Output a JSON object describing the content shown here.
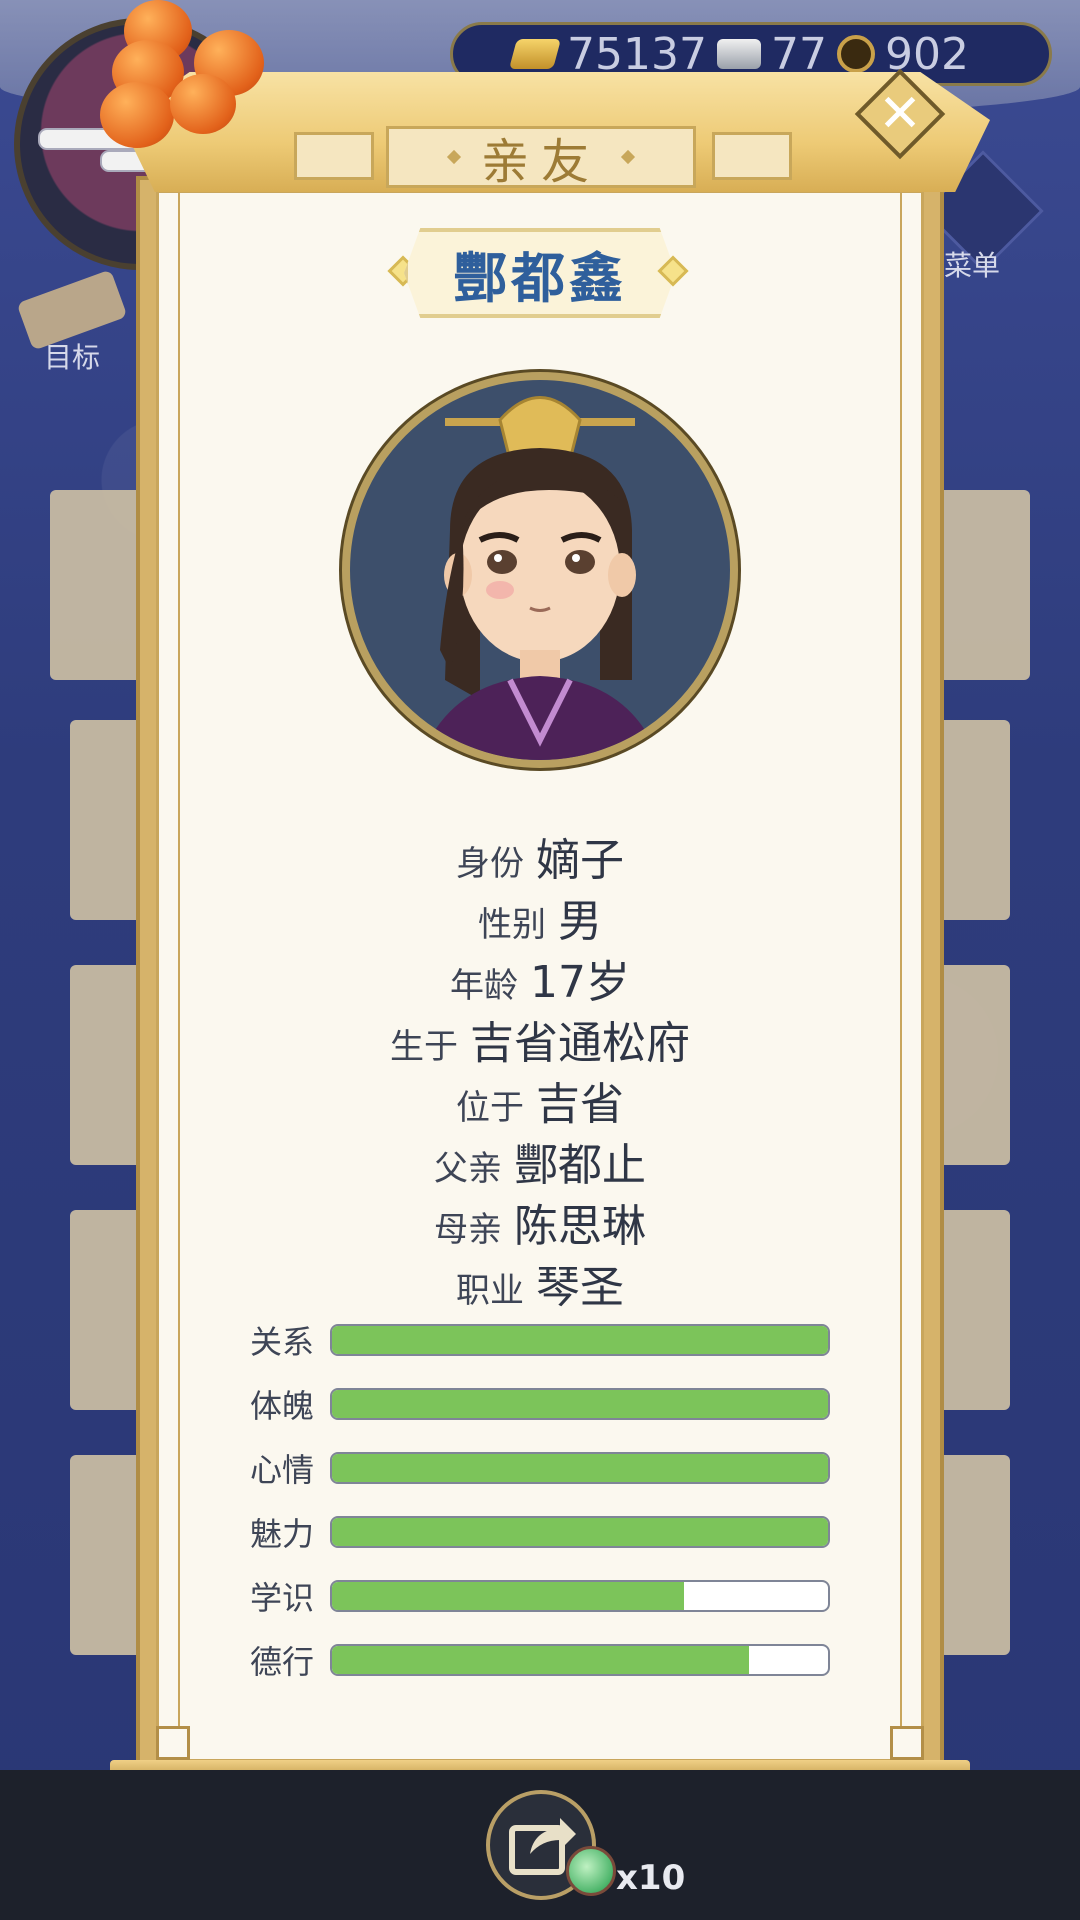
{
  "currency": {
    "gold": "75137",
    "silver": "77",
    "coins": "902"
  },
  "nav": {
    "menu_label": "菜单",
    "goal_label": "目标"
  },
  "dialog": {
    "title": "亲友",
    "close_symbol": "✕",
    "person_name": "酆都鑫"
  },
  "info": [
    {
      "key": "身份",
      "value": "嫡子"
    },
    {
      "key": "性别",
      "value": "男"
    },
    {
      "key": "年龄",
      "value": "17岁"
    },
    {
      "key": "生于",
      "value": "吉省通松府"
    },
    {
      "key": "位于",
      "value": "吉省"
    },
    {
      "key": "父亲",
      "value": "酆都止"
    },
    {
      "key": "母亲",
      "value": "陈思琳"
    },
    {
      "key": "职业",
      "value": "琴圣"
    }
  ],
  "stats": [
    {
      "label": "关系",
      "fraction": 1.0
    },
    {
      "label": "体魄",
      "fraction": 1.0
    },
    {
      "label": "心情",
      "fraction": 1.0
    },
    {
      "label": "魅力",
      "fraction": 1.0
    },
    {
      "label": "学识",
      "fraction": 0.71
    },
    {
      "label": "德行",
      "fraction": 0.84
    }
  ],
  "bottom": {
    "item_count": "x10"
  },
  "colors": {
    "stat_fill": "#7cc45a",
    "name_text": "#2f5f9c",
    "scroll_gold": "#d6b36a",
    "panel_bg": "#fbf8ef",
    "background_blue": "#2f3d7c"
  },
  "icons": {
    "close": "close-icon",
    "share": "share-icon",
    "menu": "menu-dots-icon",
    "goal": "scroll-goal-icon",
    "gold": "gold-ingot-icon",
    "silver": "silver-ingot-icon",
    "coin": "copper-coin-icon",
    "jade": "jade-item-icon"
  }
}
